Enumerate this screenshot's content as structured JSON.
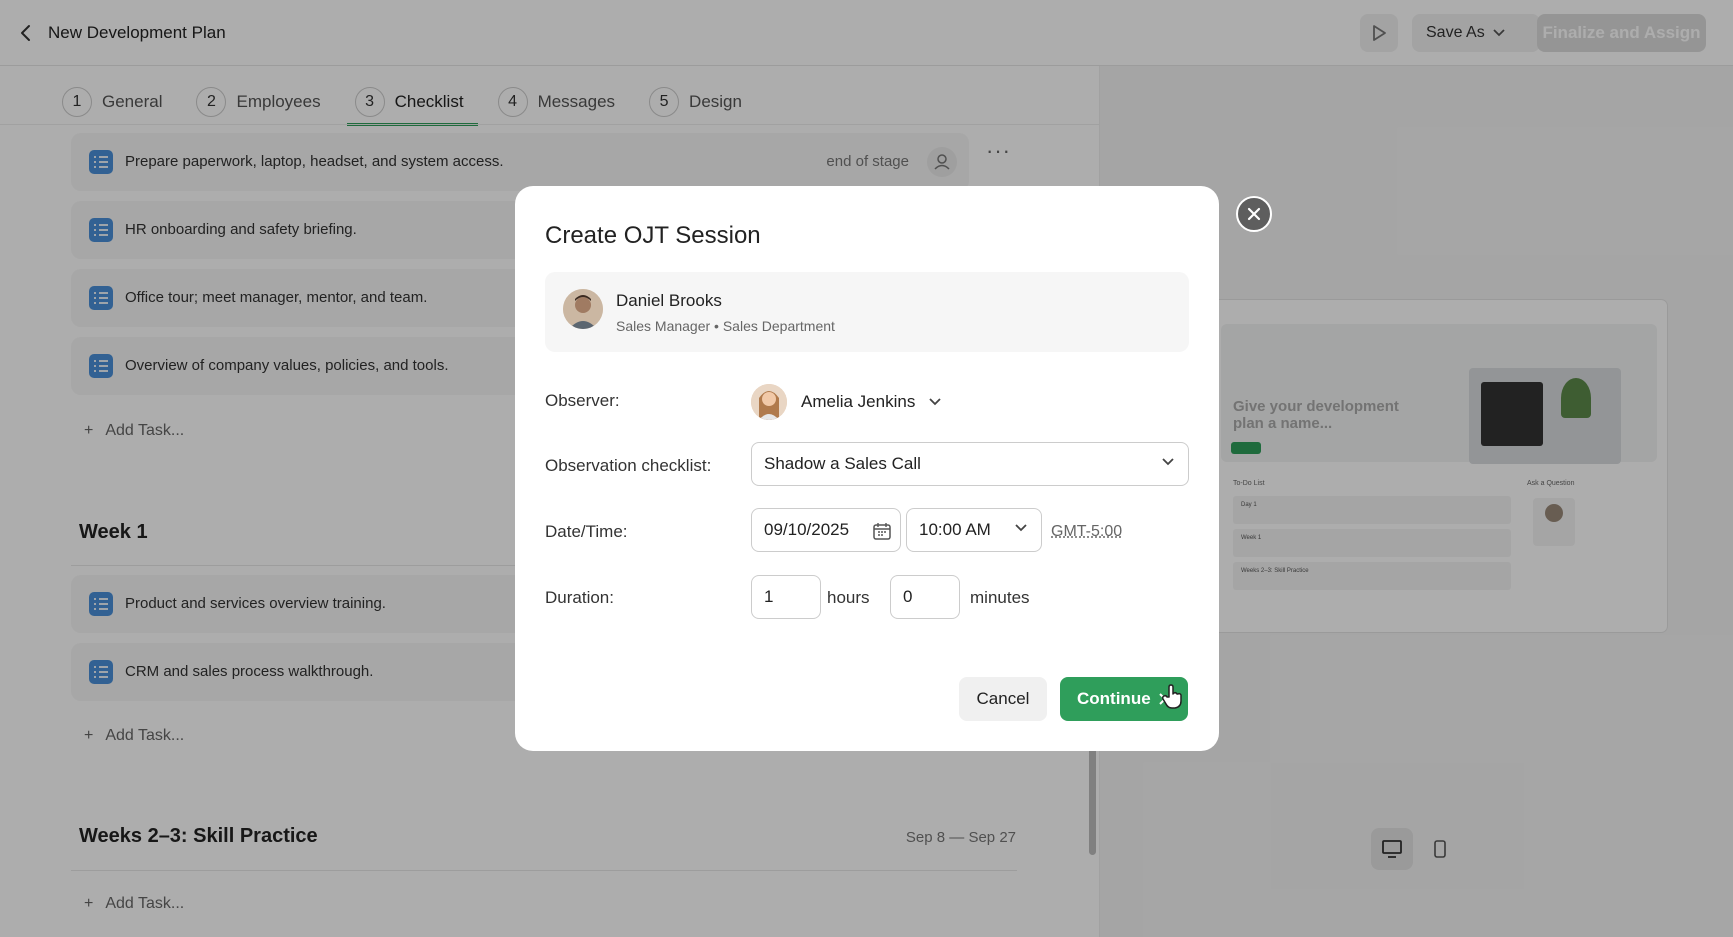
{
  "header": {
    "title": "New Development Plan",
    "save_as_label": "Save As",
    "finalize_label": "Finalize and Assign"
  },
  "steps": [
    {
      "num": "1",
      "label": "General"
    },
    {
      "num": "2",
      "label": "Employees"
    },
    {
      "num": "3",
      "label": "Checklist"
    },
    {
      "num": "4",
      "label": "Messages"
    },
    {
      "num": "5",
      "label": "Design"
    }
  ],
  "checklist": {
    "tasks": [
      {
        "text": "Prepare paperwork, laptop, headset, and system access.",
        "meta": "end of stage"
      },
      {
        "text": "HR onboarding and safety briefing."
      },
      {
        "text": "Office tour; meet manager, mentor, and team."
      },
      {
        "text": "Overview of company values, policies, and tools."
      }
    ],
    "add_task_label": "Add Task...",
    "week1": {
      "title": "Week 1",
      "tasks": [
        {
          "text": "Product and services overview training."
        },
        {
          "text": "CRM and sales process walkthrough."
        }
      ]
    },
    "weeks23": {
      "title": "Weeks 2–3: Skill Practice",
      "range": "Sep 8 — Sep 27"
    }
  },
  "preview": {
    "headline": "Give your development plan a name...",
    "todo_label": "To-Do List",
    "ask_label": "Ask a Question",
    "rows": [
      "Day 1",
      "Week 1",
      "Weeks 2–3: Skill Practice"
    ]
  },
  "modal": {
    "title": "Create OJT Session",
    "employee": {
      "name": "Daniel Brooks",
      "role": "Sales Manager • Sales Department"
    },
    "observer_label": "Observer:",
    "observer_name": "Amelia Jenkins",
    "checklist_label": "Observation checklist:",
    "checklist_value": "Shadow a Sales Call",
    "datetime_label": "Date/Time:",
    "date_value": "09/10/2025",
    "time_value": "10:00 AM",
    "timezone": "GMT-5:00",
    "duration_label": "Duration:",
    "hours_value": "1",
    "hours_unit": "hours",
    "minutes_value": "0",
    "minutes_unit": "minutes",
    "cancel_label": "Cancel",
    "continue_label": "Continue"
  },
  "colors": {
    "accent": "#2f9e5b",
    "task_icon": "#4a90d9",
    "overlay": "rgba(0,0,0,0.32)"
  }
}
